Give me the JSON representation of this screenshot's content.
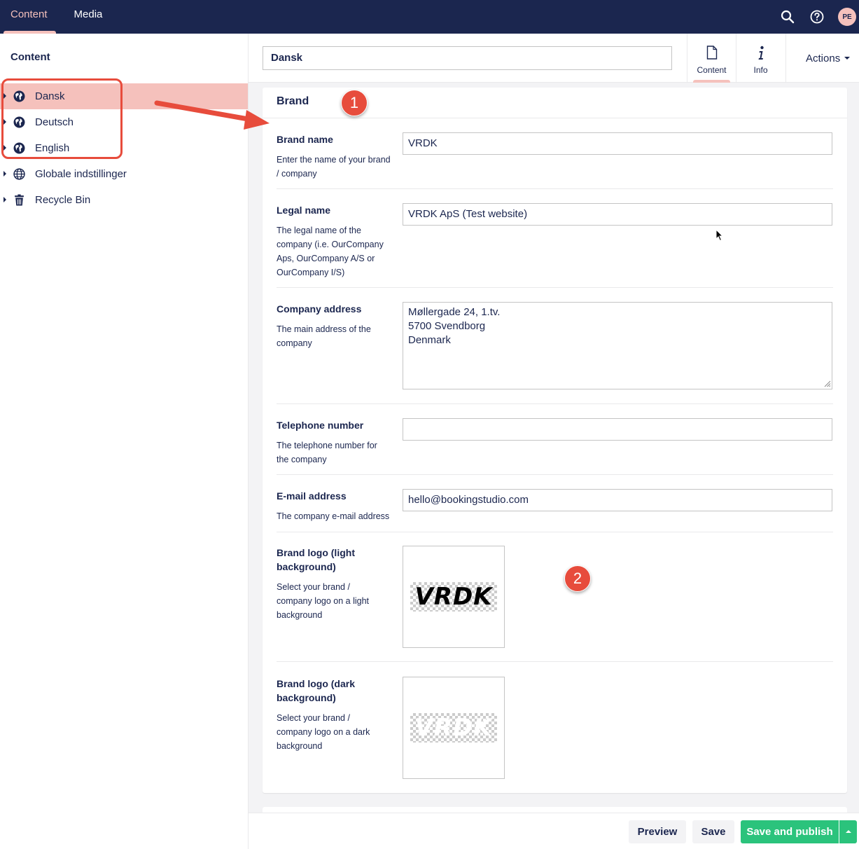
{
  "topnav": {
    "tabs": [
      {
        "label": "Content",
        "active": true
      },
      {
        "label": "Media",
        "active": false
      }
    ],
    "icons": [
      "search-icon",
      "help-icon"
    ],
    "avatar_initials": "PE"
  },
  "sidebar": {
    "title": "Content",
    "items": [
      {
        "label": "Dansk",
        "icon": "globe-icon",
        "active": true
      },
      {
        "label": "Deutsch",
        "icon": "globe-icon",
        "active": false
      },
      {
        "label": "English",
        "icon": "globe-icon",
        "active": false
      },
      {
        "label": "Globale indstillinger",
        "icon": "globe-grid-icon",
        "active": false
      },
      {
        "label": "Recycle Bin",
        "icon": "trash-icon",
        "active": false
      }
    ]
  },
  "editor": {
    "node_name": "Dansk",
    "apps": [
      {
        "label": "Content",
        "icon": "document-icon",
        "active": true
      },
      {
        "label": "Info",
        "icon": "info-icon",
        "active": false
      }
    ],
    "actions_label": "Actions"
  },
  "panel": {
    "title": "Brand",
    "properties": {
      "brand_name": {
        "label": "Brand name",
        "description": "Enter the name of your brand / company",
        "value": "VRDK"
      },
      "legal_name": {
        "label": "Legal name",
        "description": "The legal name of the company (i.e. OurCompany Aps, OurCompany A/S or OurCompany I/S)",
        "value": "VRDK ApS (Test website)"
      },
      "address": {
        "label": "Company address",
        "description": "The main address of the company",
        "value": "Møllergade 24, 1.tv.\n5700 Svendborg\nDenmark"
      },
      "telephone": {
        "label": "Telephone number",
        "description": "The telephone number for the company",
        "value": ""
      },
      "email": {
        "label": "E-mail address",
        "description": "The company e-mail address",
        "value": "hello@bookingstudio.com"
      },
      "logo_light": {
        "label": "Brand logo (light background)",
        "description": "Select your brand / company logo on a light background",
        "logo_text": "VRDK"
      },
      "logo_dark": {
        "label": "Brand logo (dark background)",
        "description": "Select your brand / company logo on a dark background",
        "logo_text": "VRDK"
      }
    }
  },
  "annotations": {
    "badge1": "1",
    "badge2": "2"
  },
  "footer": {
    "preview": "Preview",
    "save": "Save",
    "save_publish": "Save and publish"
  },
  "colors": {
    "header_bg": "#1b264f",
    "accent_pink": "#f5c1bc",
    "publish_green": "#2bc37c",
    "annotation_red": "#e74c3c"
  }
}
